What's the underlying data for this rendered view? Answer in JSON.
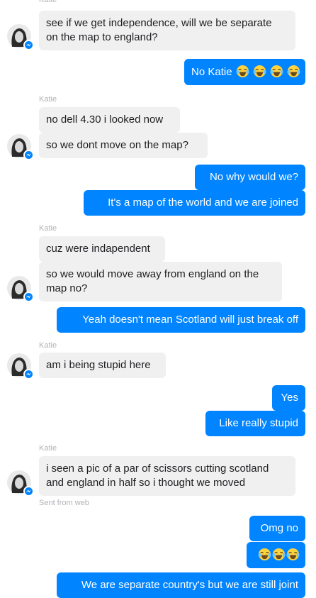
{
  "colors": {
    "outgoing": "#0084ff",
    "incoming": "#f1f0f0",
    "meta": "#b0b2b7"
  },
  "contact": {
    "name": "Katie"
  },
  "messages": [
    {
      "text1": "see if we get independence, will we be separate",
      "text2": "on the map to england?"
    },
    {
      "text": "No Katie",
      "emoji_count": 4,
      "emoji": "face-with-tears-of-joy"
    },
    {
      "text": "no dell 4.30 i looked now"
    },
    {
      "text": "so we dont move on the map?"
    },
    {
      "text": "No why would we?"
    },
    {
      "text": "It's a map of the world and we are joined"
    },
    {
      "text": "cuz were indapendent"
    },
    {
      "text1": "so we would move away from england on the",
      "text2": "map no?"
    },
    {
      "text": "Yeah doesn't mean Scotland will just break off"
    },
    {
      "text": "am i being stupid here"
    },
    {
      "text": "Yes"
    },
    {
      "text": "Like really stupid"
    },
    {
      "text1": "i seen a pic of a par of scissors cutting scotland",
      "text2": "and england in half so i thought we moved"
    },
    {
      "text": "Omg no"
    },
    {
      "emoji_count": 3,
      "emoji": "face-with-tears-of-joy"
    },
    {
      "text": "We are separate country's but we are still joint"
    }
  ],
  "meta": {
    "sent_from": "Sent from web"
  }
}
